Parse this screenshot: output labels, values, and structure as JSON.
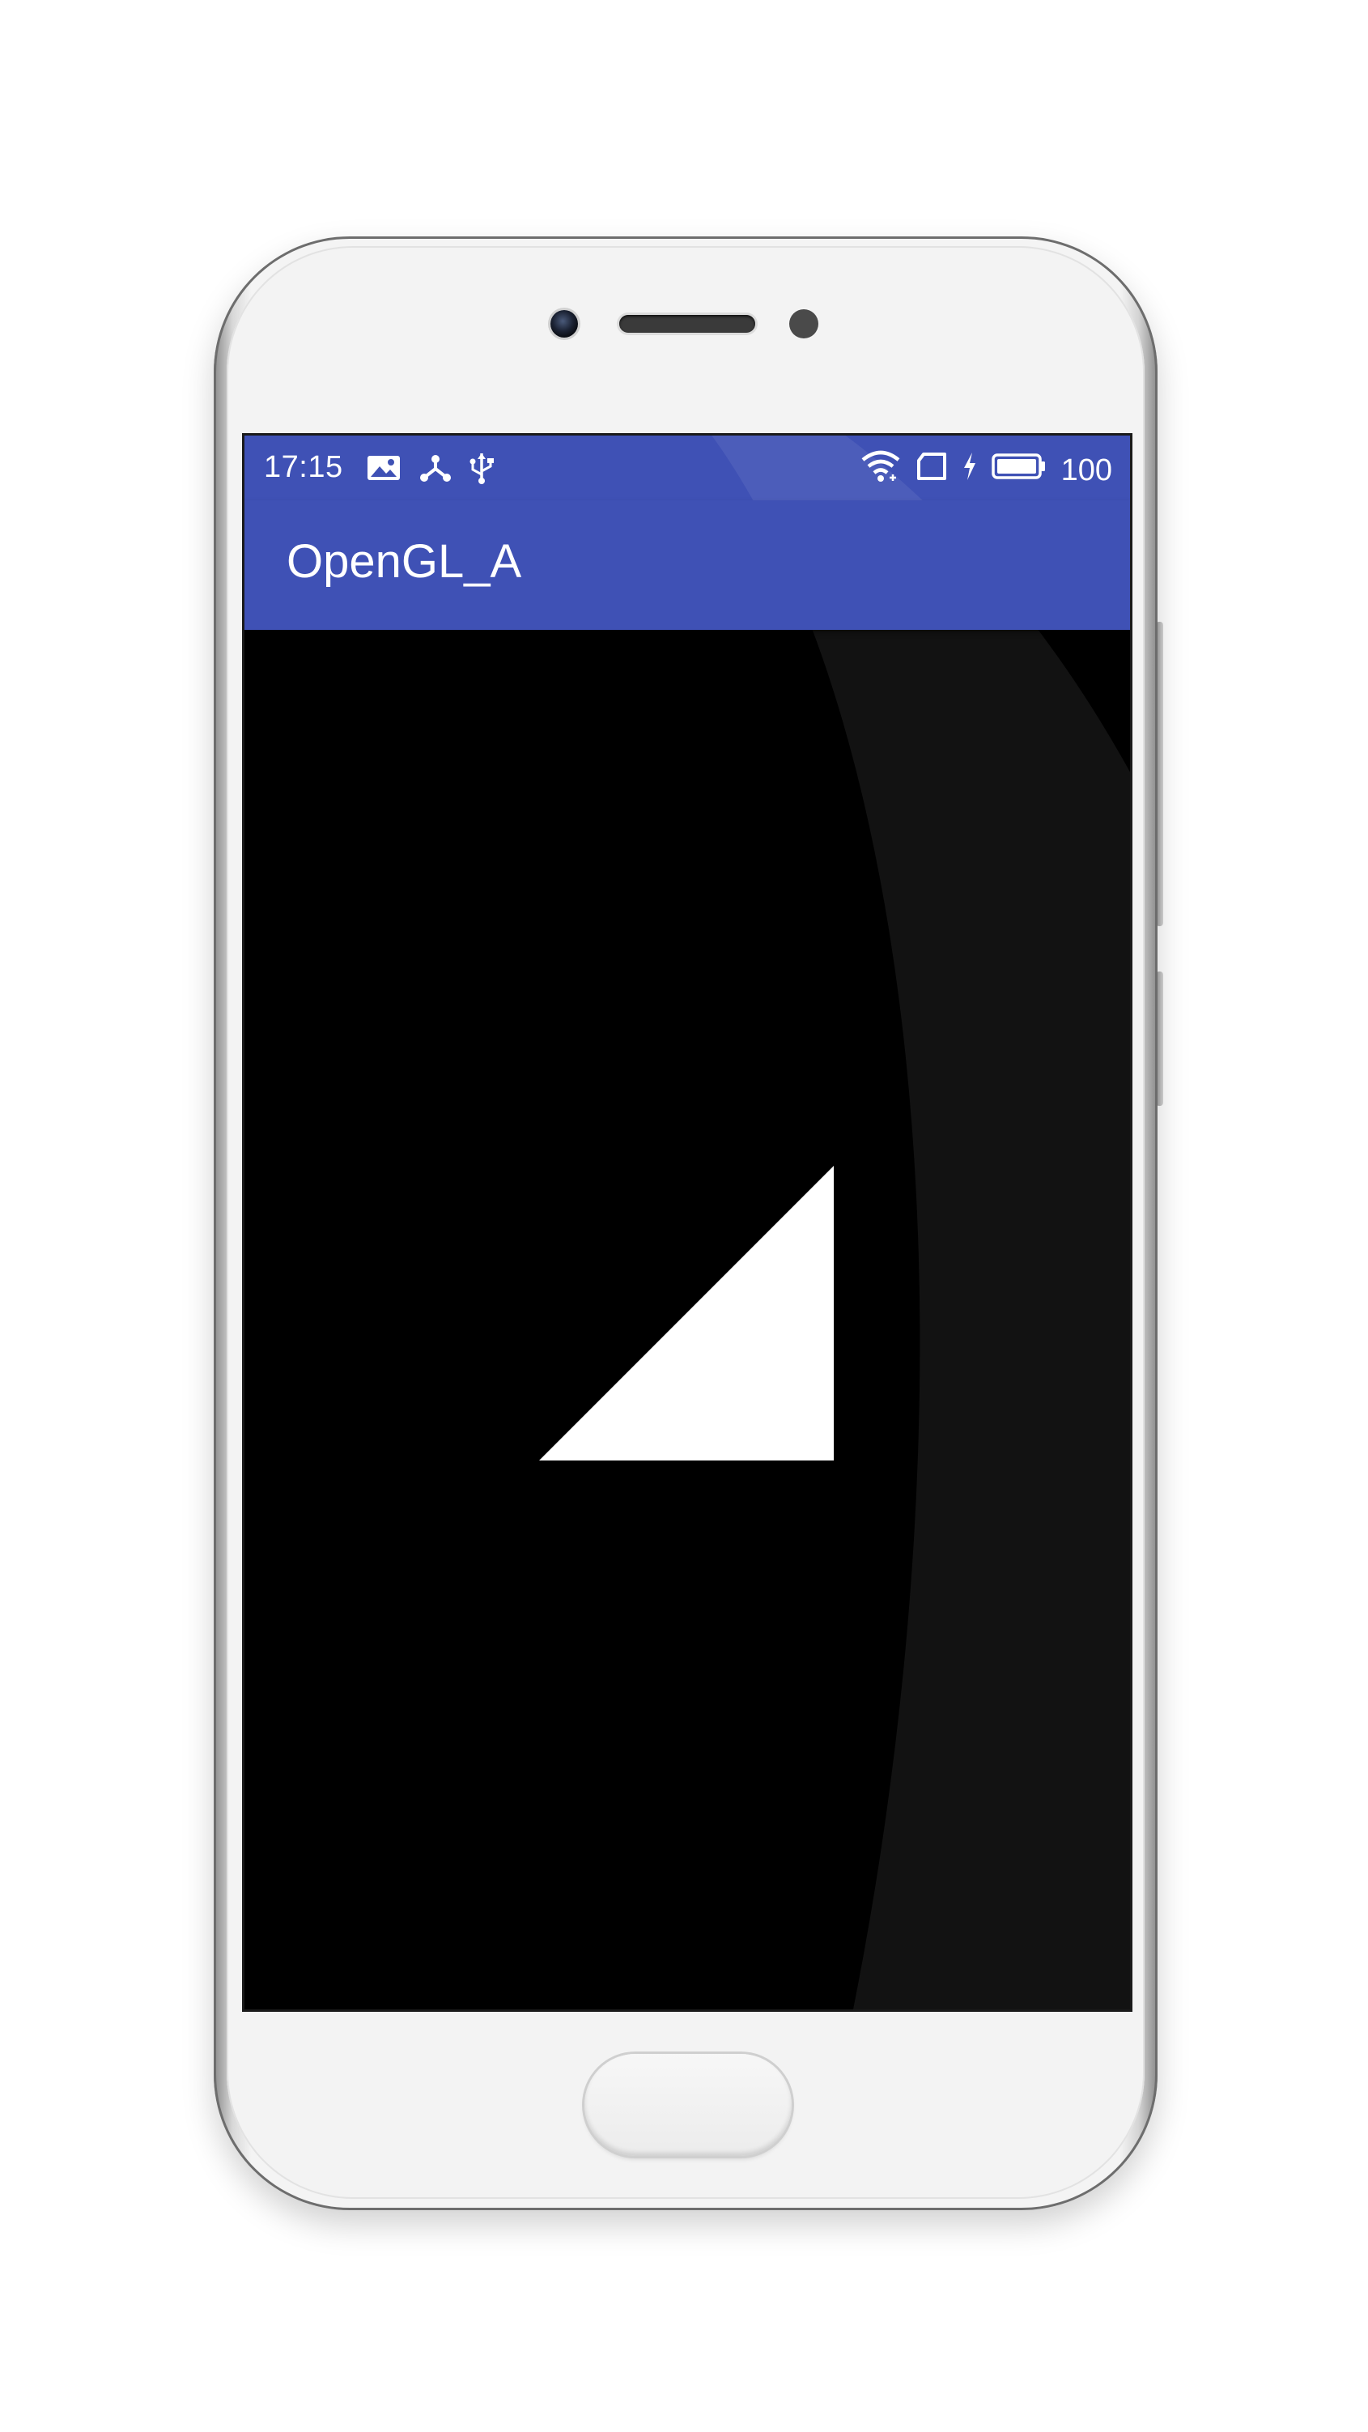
{
  "status_bar": {
    "time": "17:15",
    "left_icons": [
      "image-icon",
      "share-nodes-icon",
      "usb-icon"
    ],
    "right_icons": [
      "wifi-icon",
      "sim-card-icon",
      "charging-bolt-icon",
      "battery-icon"
    ],
    "battery_level": "100"
  },
  "app_bar": {
    "title": "OpenGL_A",
    "color": "#3f51b5"
  },
  "gl_surface": {
    "background": "#000000",
    "shape": "triangle",
    "shape_color": "#ffffff"
  }
}
